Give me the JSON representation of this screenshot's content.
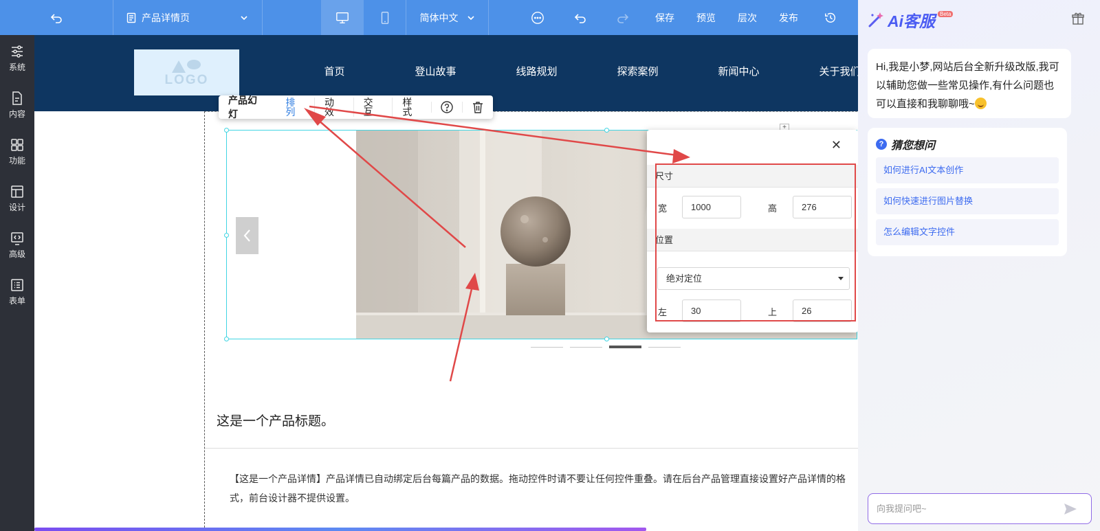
{
  "toolbar": {
    "page_name": "产品详情页",
    "language": "简体中文",
    "save": "保存",
    "preview": "预览",
    "layers": "层次",
    "publish": "发布"
  },
  "sidebar": {
    "items": [
      {
        "label": "系统",
        "icon": "sliders-icon"
      },
      {
        "label": "内容",
        "icon": "document-icon"
      },
      {
        "label": "功能",
        "icon": "grid-icon"
      },
      {
        "label": "设计",
        "icon": "layout-icon"
      },
      {
        "label": "高级",
        "icon": "code-icon"
      },
      {
        "label": "表单",
        "icon": "list-icon"
      }
    ]
  },
  "site": {
    "logo_text": "LOGO",
    "nav": [
      "首页",
      "登山故事",
      "线路规划",
      "探索案例",
      "新闻中心",
      "关于我们"
    ]
  },
  "component_toolbar": {
    "title": "产品幻灯",
    "items": [
      "排列",
      "动效",
      "交互",
      "样式"
    ],
    "active": "排列"
  },
  "property_panel": {
    "size_section": "尺寸",
    "width_label": "宽",
    "width_value": "1000",
    "height_label": "高",
    "height_value": "276",
    "position_section": "位置",
    "position_mode": "绝对定位",
    "left_label": "左",
    "left_value": "30",
    "top_label": "上",
    "top_value": "26"
  },
  "product": {
    "title": "这是一个产品标题。",
    "description": "【这是一个产品详情】产品详情已自动绑定后台每篇产品的数据。拖动控件时请不要让任何控件重叠。请在后台产品管理直接设置好产品详情的格式，前台设计器不提供设置。"
  },
  "slider": {
    "dot_count": 4,
    "active_dot": 3
  },
  "ai": {
    "title": "Ai客服",
    "badge": "Beta",
    "greeting": "Hi,我是小梦,网站后台全新升级改版,我可以辅助您做一些常见操作,有什么问题也可以直接和我聊聊哦~",
    "guess_title": "猜您想问",
    "questions": [
      "如何进行AI文本创作",
      "如何快速进行图片替换",
      "怎么编辑文字控件"
    ],
    "input_placeholder": "向我提问吧~"
  },
  "colors": {
    "toolbar_bg": "#4d91e8",
    "sidebar_bg": "#2d3038",
    "site_header_bg": "#0e3661",
    "accent_blue": "#2f7de1",
    "selection_cyan": "#40d5e3",
    "annotation_red": "#e04848"
  }
}
